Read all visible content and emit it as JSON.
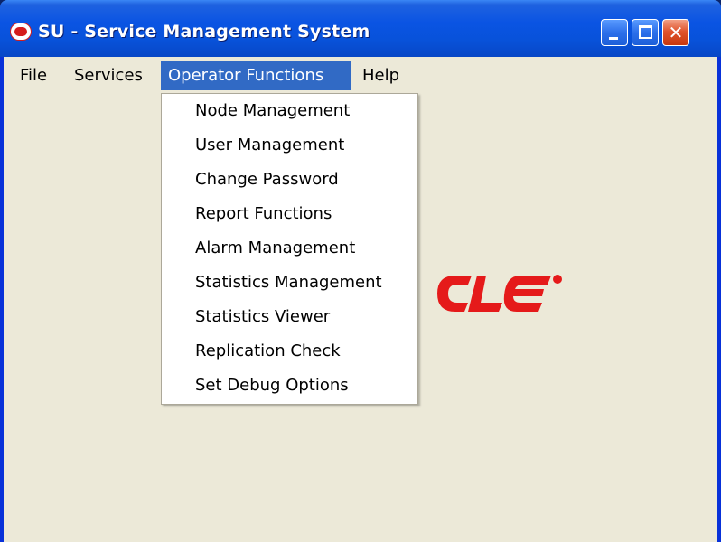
{
  "window": {
    "title": "SU - Service Management System",
    "icon": "oracle-o-icon"
  },
  "titlebar_buttons": {
    "minimize_icon": "minimize-icon",
    "maximize_icon": "maximize-icon",
    "close_icon": "close-icon",
    "close_glyph": "✕"
  },
  "menubar": {
    "items": [
      {
        "label": "File"
      },
      {
        "label": "Services"
      },
      {
        "label": "Operator Functions",
        "active": true
      },
      {
        "label": "Help"
      }
    ]
  },
  "dropdown": {
    "items": [
      {
        "label": "Node Management"
      },
      {
        "label": "User Management"
      },
      {
        "label": "Change Password"
      },
      {
        "label": "Report Functions"
      },
      {
        "label": "Alarm Management"
      },
      {
        "label": "Statistics Management"
      },
      {
        "label": "Statistics Viewer"
      },
      {
        "label": "Replication Check"
      },
      {
        "label": "Set Debug Options"
      }
    ]
  },
  "background_logo": {
    "name": "oracle-logo",
    "visible_text": "CLE",
    "color": "#e51a1a"
  },
  "colors": {
    "titlebar": "#0a54e3",
    "menu_highlight": "#316ac5",
    "client_bg": "#ece9d8",
    "close_button": "#e0542d"
  }
}
